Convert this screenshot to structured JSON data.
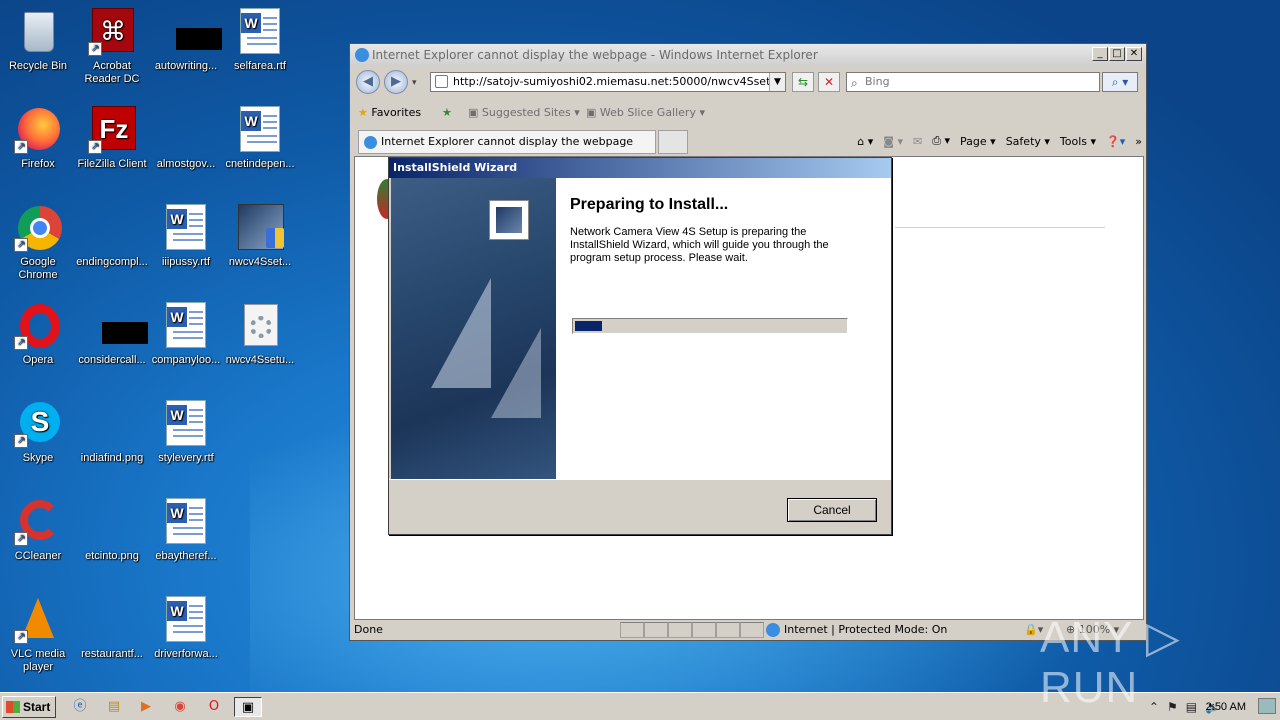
{
  "desktop": {
    "icons": [
      {
        "label": "Recycle Bin",
        "icon": "recycle-bin-icon"
      },
      {
        "label": "Acrobat Reader DC",
        "icon": "acrobat-icon"
      },
      {
        "label": "autowriting...",
        "icon": "file-icon"
      },
      {
        "label": "selfarea.rtf",
        "icon": "word-doc-icon"
      },
      {
        "label": "Firefox",
        "icon": "firefox-icon"
      },
      {
        "label": "FileZilla Client",
        "icon": "filezilla-icon"
      },
      {
        "label": "almostgov...",
        "icon": "file-icon"
      },
      {
        "label": "cnetindepen...",
        "icon": "word-doc-icon"
      },
      {
        "label": "Google Chrome",
        "icon": "chrome-icon"
      },
      {
        "label": "endingcompl...",
        "icon": "file-icon"
      },
      {
        "label": "iiipussy.rtf",
        "icon": "word-doc-icon"
      },
      {
        "label": "nwcv4Sset...",
        "icon": "installer-icon"
      },
      {
        "label": "Opera",
        "icon": "opera-icon"
      },
      {
        "label": "considercall...",
        "icon": "file-icon"
      },
      {
        "label": "companyloo...",
        "icon": "word-doc-icon"
      },
      {
        "label": "nwcv4Ssetu...",
        "icon": "setup-gear-icon"
      },
      {
        "label": "Skype",
        "icon": "skype-icon"
      },
      {
        "label": "indiafind.png",
        "icon": "image-icon"
      },
      {
        "label": "stylevery.rtf",
        "icon": "word-doc-icon"
      },
      {
        "label": "CCleaner",
        "icon": "ccleaner-icon"
      },
      {
        "label": "etcinto.png",
        "icon": "image-icon"
      },
      {
        "label": "ebaytheref...",
        "icon": "word-doc-icon"
      },
      {
        "label": "VLC media player",
        "icon": "vlc-icon"
      },
      {
        "label": "restaurantf...",
        "icon": "image-icon"
      },
      {
        "label": "driverforwa...",
        "icon": "word-doc-icon"
      }
    ]
  },
  "ie": {
    "title": "Internet Explorer cannot display the webpage - Windows Internet Explorer",
    "address": "http://satojv-sumiyoshi02.miemasu.net:50000/nwcv4Ssetup.cab",
    "search_placeholder": "Bing",
    "favorites": "Favorites",
    "suggested": "Suggested Sites ▾",
    "webslice": "Web Slice Gallery ▾",
    "tab_title": "Internet Explorer cannot display the webpage",
    "cmd_page": "Page ▾",
    "cmd_safety": "Safety ▾",
    "cmd_tools": "Tools ▾",
    "status_done": "Done",
    "status_zone": "Internet | Protected Mode: On",
    "zoom": "100%"
  },
  "dialog": {
    "title": "InstallShield Wizard",
    "heading": "Preparing to Install...",
    "body": "Network Camera View 4S Setup is preparing the InstallShield Wizard, which will guide you through the program setup process.  Please wait.",
    "progress": 0.1,
    "cancel": "Cancel"
  },
  "taskbar": {
    "start": "Start",
    "clock": "2:50 AM"
  },
  "watermark": "ANY ▷ RUN",
  "colors": {
    "dialog_title_start": "#0a246a",
    "progress_fill": "#0a246a"
  }
}
